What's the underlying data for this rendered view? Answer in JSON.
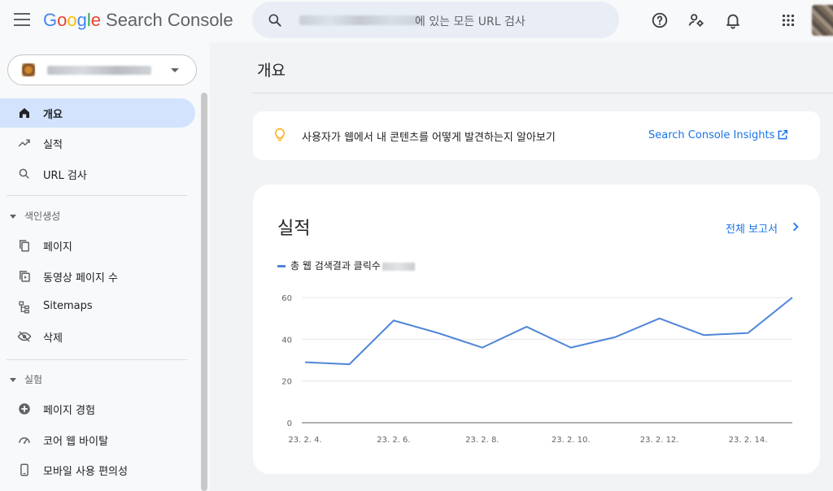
{
  "header": {
    "logo_google": [
      "G",
      "o",
      "o",
      "g",
      "l",
      "e"
    ],
    "product": "Search Console",
    "search_placeholder": "에 있는 모든 URL 검사"
  },
  "icons": {
    "menu": "menu-icon",
    "search": "search-icon",
    "help": "help-icon",
    "settings": "user-settings-icon",
    "notifications": "bell-icon",
    "apps": "apps-grid-icon"
  },
  "sidebar": {
    "items": [
      {
        "label": "개요",
        "icon": "home-icon",
        "active": true
      },
      {
        "label": "실적",
        "icon": "trending-up-icon"
      },
      {
        "label": "URL 검사",
        "icon": "search-icon"
      }
    ],
    "sections": [
      {
        "title": "색인생성",
        "items": [
          {
            "label": "페이지",
            "icon": "pages-icon"
          },
          {
            "label": "동영상 페이지 수",
            "icon": "video-pages-icon"
          },
          {
            "label": "Sitemaps",
            "icon": "sitemap-icon"
          },
          {
            "label": "삭제",
            "icon": "removal-icon"
          }
        ]
      },
      {
        "title": "실험",
        "items": [
          {
            "label": "페이지 경험",
            "icon": "page-experience-icon"
          },
          {
            "label": "코어 웹 바이탈",
            "icon": "speedometer-icon"
          },
          {
            "label": "모바일 사용 편의성",
            "icon": "mobile-icon"
          }
        ]
      }
    ]
  },
  "main": {
    "page_title": "개요",
    "insights": {
      "text": "사용자가 웹에서 내 콘텐츠를 어떻게 발견하는지 알아보기",
      "link": "Search Console Insights"
    },
    "performance": {
      "title": "실적",
      "full_report": "전체 보고서",
      "legend": "총 웹 검색결과 클릭수"
    }
  },
  "colors": {
    "accent": "#1a73e8",
    "line": "#4e86d8",
    "active_bg": "#d3e3fd",
    "bulb": "#f9ab00"
  },
  "chart_data": {
    "type": "line",
    "series": [
      {
        "name": "총 웹 검색결과 클릭수",
        "values": [
          29,
          28,
          49,
          43,
          36,
          46,
          36,
          41,
          50,
          42,
          43,
          60
        ]
      }
    ],
    "x": [
      "23. 2. 4.",
      "23. 2. 5.",
      "23. 2. 6.",
      "23. 2. 7.",
      "23. 2. 8.",
      "23. 2. 9.",
      "23. 2. 10.",
      "23. 2. 11.",
      "23. 2. 12.",
      "23. 2. 13.",
      "23. 2. 14.",
      "23. 2. 15."
    ],
    "x_tick_labels": [
      "23. 2. 4.",
      "23. 2. 6.",
      "23. 2. 8.",
      "23. 2. 10.",
      "23. 2. 12.",
      "23. 2. 14."
    ],
    "y_ticks": [
      0,
      20,
      40,
      60
    ],
    "ylim": [
      0,
      60
    ],
    "grid": true
  }
}
